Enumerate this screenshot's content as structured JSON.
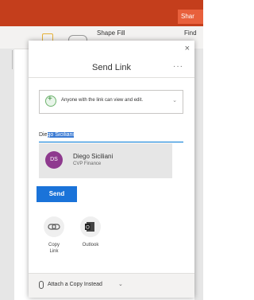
{
  "appbar": {
    "share_label": "Shar"
  },
  "ribbon": {
    "shape_fill": "Shape Fill",
    "find": "Find"
  },
  "dialog": {
    "title": "Send Link",
    "close_glyph": "×",
    "more_glyph": "···"
  },
  "permission": {
    "text": "Anyone with the link can view and edit.",
    "chevron": "⌄"
  },
  "recipient": {
    "prefix": "Die",
    "selected": "go Siciliani"
  },
  "suggestion": {
    "initials": "DS",
    "name": "Diego Siciliani",
    "role": "CVP Finance"
  },
  "send_label": "Send",
  "actions": [
    {
      "label": "Copy\nLink",
      "icon": "link-icon"
    },
    {
      "label": "Outlook",
      "icon": "outlook-icon"
    }
  ],
  "attach": {
    "label": "Attach a Copy Instead",
    "chevron": "⌄"
  },
  "colors": {
    "app_orange": "#c43e1c",
    "accent_blue": "#1a73d9",
    "avatar_purple": "#8e3a8e"
  }
}
